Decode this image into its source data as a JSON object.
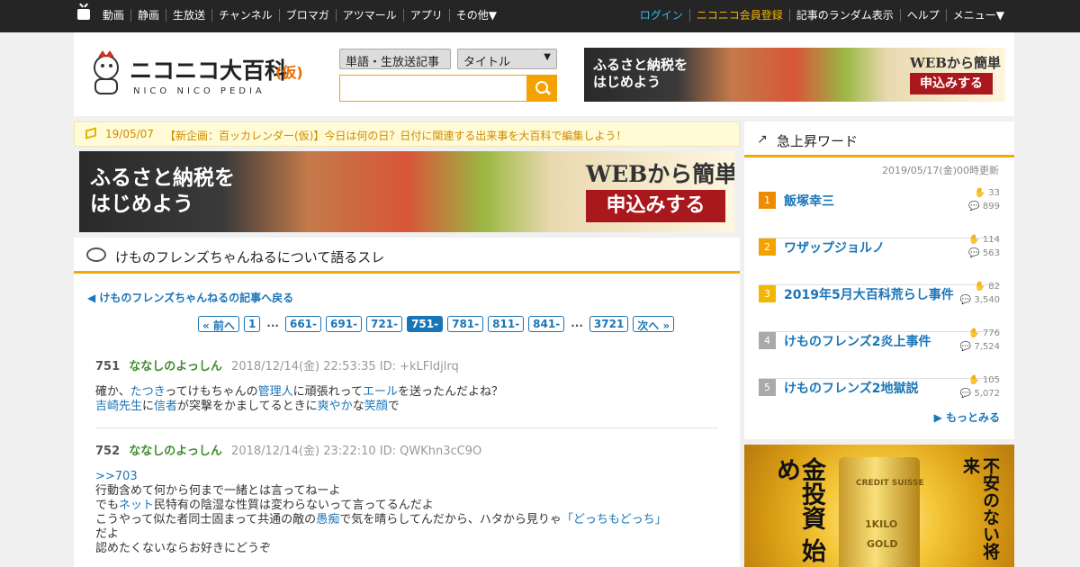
{
  "topnav": {
    "left": [
      "動画",
      "静画",
      "生放送",
      "チャンネル",
      "ブロマガ",
      "アツマール",
      "アプリ",
      "その他▼"
    ],
    "login": "ログイン",
    "register": "ニコニコ会員登録",
    "right": [
      "記事のランダム表示",
      "ヘルプ",
      "メニュー▼"
    ]
  },
  "logo": {
    "main": "ニコニコ大百科",
    "suffix": "(仮)",
    "sub": "NICO NICO PEDIA"
  },
  "search": {
    "type_select": "単語・生放送記事",
    "field_select": "タイトル",
    "query": ""
  },
  "ad_banner": {
    "line1": "ふるさと納税を\nはじめよう",
    "line2": "WEBから簡単",
    "button": "申込みする"
  },
  "notice": {
    "date": "19/05/07",
    "text": "【新企画：百ッカレンダー(仮)】今日は何の日？日付に関連する出来事を大百科で編集しよう！"
  },
  "thread": {
    "title": "けものフレンズちゃんねるについて語るスレ",
    "back_link": "けものフレンズちゃんねるの記事へ戻る",
    "pager": [
      "« 前へ",
      "1",
      "...",
      "661-",
      "691-",
      "721-",
      "751-",
      "781-",
      "811-",
      "841-",
      "...",
      "3721",
      "次へ »"
    ],
    "current_page": "751-",
    "posts": [
      {
        "num": "751",
        "name": "ななしのよっしん",
        "meta": "2018/12/14(金) 22:53:35 ID: +kLFldjlrq"
      },
      {
        "num": "752",
        "name": "ななしのよっしん",
        "meta": "2018/12/14(金) 23:22:10 ID: QWKhn3cC9O"
      }
    ],
    "p751": {
      "a": "確か、",
      "l1": "たつき",
      "b": "ってけもちゃんの",
      "l2": "管理人",
      "c": "に頑張れって",
      "l3": "エール",
      "d": "を送ったんだよね？",
      "l4": "吉崎先生",
      "e": "に",
      "l5": "信者",
      "f": "が突撃をかましてるときに",
      "l6": "爽やか",
      "g": "な",
      "l7": "笑顔",
      "h": "で"
    },
    "p752": {
      "ref": ">>703",
      "line1": "行動含めて何から何まで一緒とは言ってねーよ",
      "a": "でも",
      "l1": "ネット",
      "b": "民特有の陰湿な性質は変わらないって言ってるんだよ",
      "c": "こうやって似た者同士固まって共通の敵の",
      "l2": "愚痴",
      "d": "で気を晴らしてんだから、ハタから見りゃ",
      "l3": "「どっちもどっち」",
      "line4": "だよ",
      "line5": "認めたくないならお好きにどうぞ"
    }
  },
  "trending": {
    "title": "急上昇ワード",
    "updated": "2019/05/17(金)00時更新",
    "items": [
      {
        "rank": "1",
        "word": "飯塚幸三",
        "s1": "33",
        "s2": "899"
      },
      {
        "rank": "2",
        "word": "ワザップジョルノ",
        "s1": "114",
        "s2": "563"
      },
      {
        "rank": "3",
        "word": "2019年5月大百科荒らし事件",
        "s1": "82",
        "s2": "3,540"
      },
      {
        "rank": "4",
        "word": "けものフレンズ2炎上事件",
        "s1": "776",
        "s2": "7,524"
      },
      {
        "rank": "5",
        "word": "けものフレンズ2地獄説",
        "s1": "105",
        "s2": "5,072"
      }
    ],
    "more": "もっとみる",
    "badge_colors": [
      "#ef8b00",
      "#f4a200",
      "#f4b700",
      "#aaaaaa",
      "#aaaaaa"
    ]
  },
  "side_ad": {
    "left": "金投資 始め",
    "right": "不安のない将来",
    "bar_top": "CREDIT SUISSE",
    "bar_mid": "1KILO",
    "bar_low": "GOLD"
  }
}
